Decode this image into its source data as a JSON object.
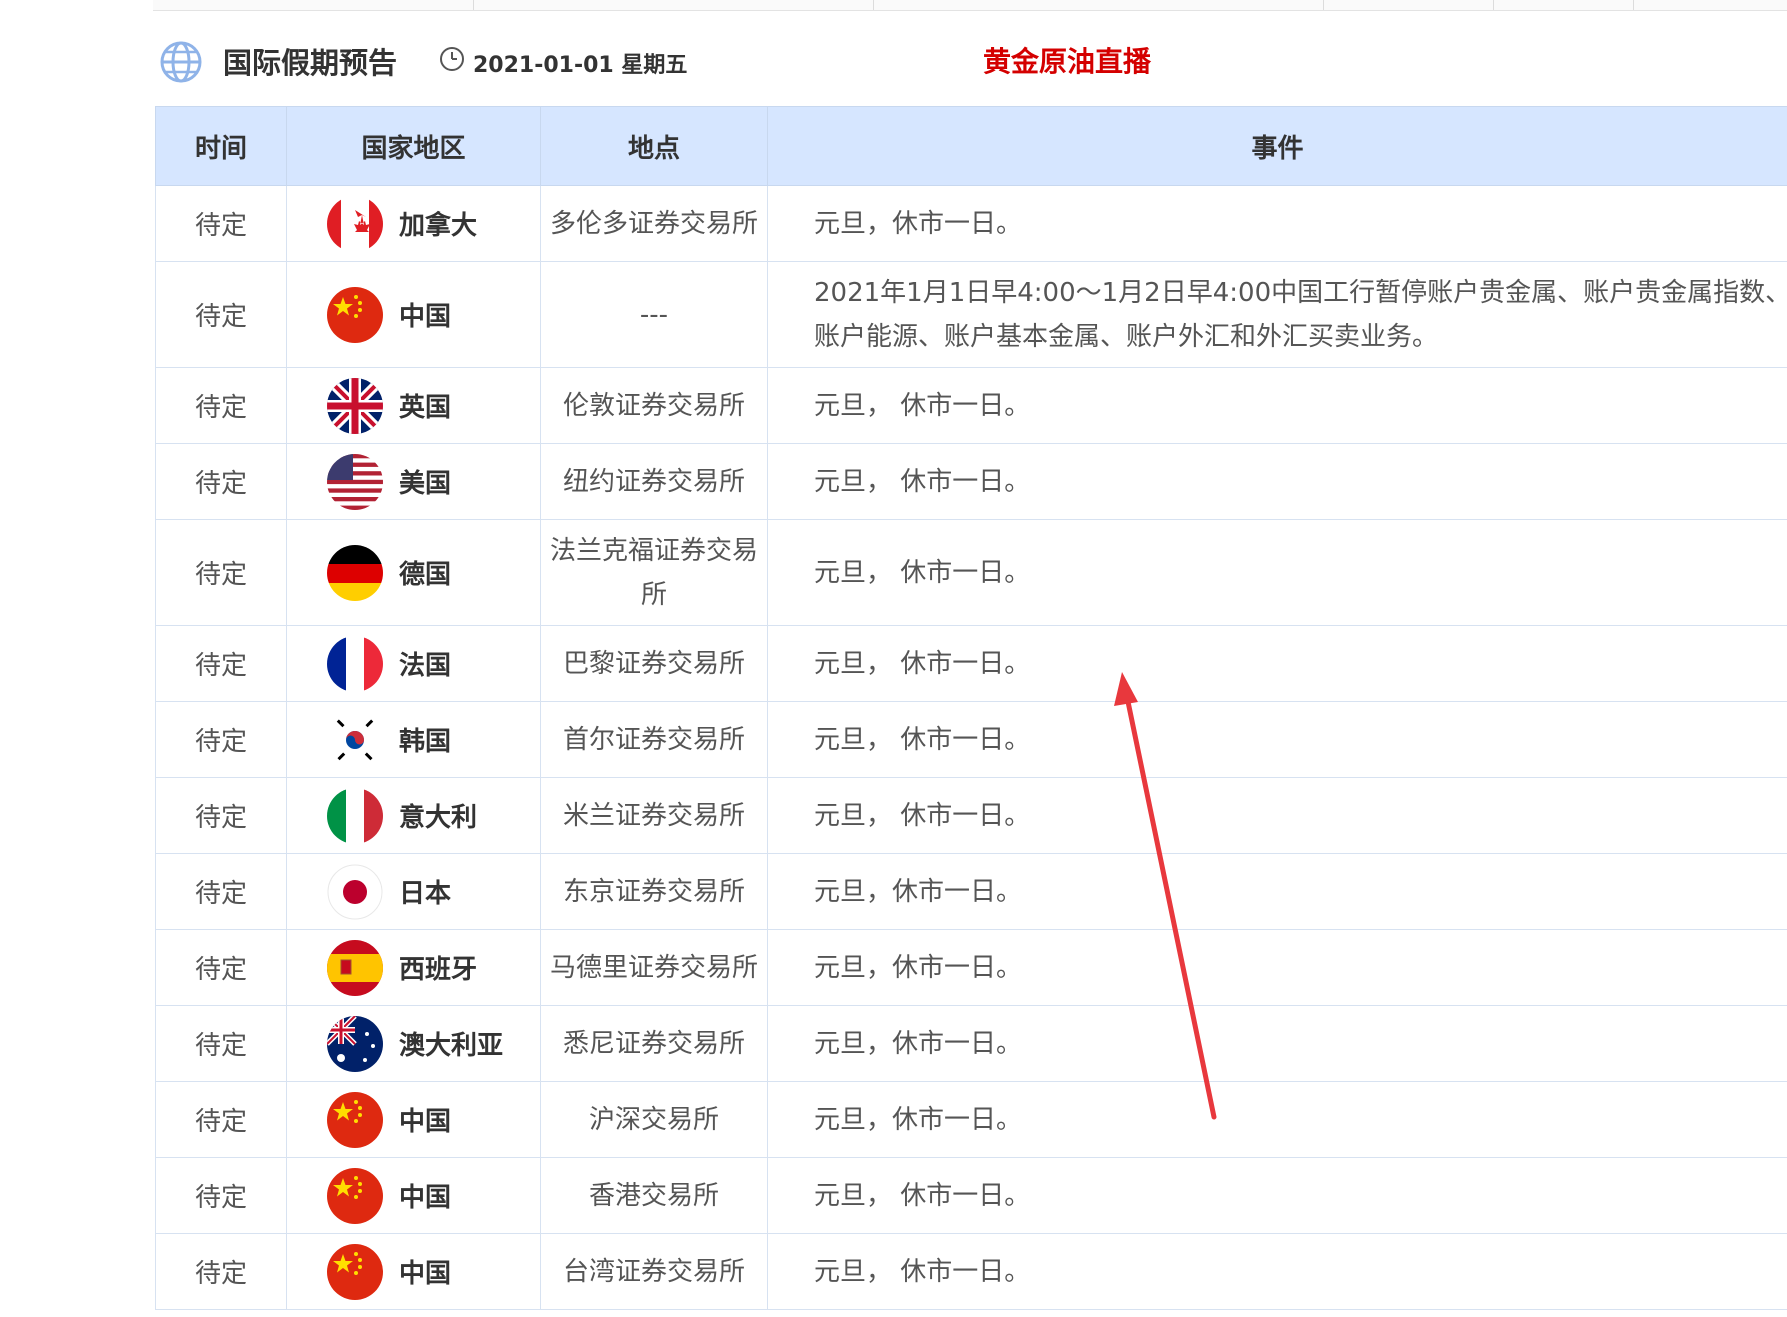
{
  "header": {
    "title": "国际假期预告",
    "date": "2021-01-01 星期五",
    "live_link": "黄金原油直播"
  },
  "table": {
    "columns": [
      "时间",
      "国家地区",
      "地点",
      "事件"
    ],
    "rows": [
      {
        "time": "待定",
        "country": "加拿大",
        "flag": "canada-flag-icon",
        "place": "多伦多证券交易所",
        "event": "元旦，休市一日。"
      },
      {
        "time": "待定",
        "country": "中国",
        "flag": "china-flag-icon",
        "place": "---",
        "event": "2021年1月1日早4:00～1月2日早4:00中国工行暂停账户贵金属、账户贵金属指数、账户能源、账户基本金属、账户外汇和外汇买卖业务。"
      },
      {
        "time": "待定",
        "country": "英国",
        "flag": "uk-flag-icon",
        "place": "伦敦证券交易所",
        "event": "元旦， 休市一日。"
      },
      {
        "time": "待定",
        "country": "美国",
        "flag": "usa-flag-icon",
        "place": "纽约证券交易所",
        "event": "元旦， 休市一日。"
      },
      {
        "time": "待定",
        "country": "德国",
        "flag": "germany-flag-icon",
        "place": "法兰克福证券交易所",
        "event": "元旦， 休市一日。"
      },
      {
        "time": "待定",
        "country": "法国",
        "flag": "france-flag-icon",
        "place": "巴黎证券交易所",
        "event": "元旦， 休市一日。"
      },
      {
        "time": "待定",
        "country": "韩国",
        "flag": "korea-flag-icon",
        "place": "首尔证券交易所",
        "event": "元旦， 休市一日。"
      },
      {
        "time": "待定",
        "country": "意大利",
        "flag": "italy-flag-icon",
        "place": "米兰证券交易所",
        "event": "元旦， 休市一日。"
      },
      {
        "time": "待定",
        "country": "日本",
        "flag": "japan-flag-icon",
        "place": "东京证券交易所",
        "event": "元旦，休市一日。"
      },
      {
        "time": "待定",
        "country": "西班牙",
        "flag": "spain-flag-icon",
        "place": "马德里证券交易所",
        "event": "元旦，休市一日。"
      },
      {
        "time": "待定",
        "country": "澳大利亚",
        "flag": "australia-flag-icon",
        "place": "悉尼证券交易所",
        "event": "元旦，休市一日。"
      },
      {
        "time": "待定",
        "country": "中国",
        "flag": "china-flag-icon",
        "place": "沪深交易所",
        "event": "元旦，休市一日。"
      },
      {
        "time": "待定",
        "country": "中国",
        "flag": "china-flag-icon",
        "place": "香港交易所",
        "event": "元旦， 休市一日。"
      },
      {
        "time": "待定",
        "country": "中国",
        "flag": "china-flag-icon",
        "place": "台湾证券交易所",
        "event": "元旦， 休市一日。"
      }
    ]
  },
  "colors": {
    "header_bg": "#d6e6ff",
    "live_link": "#d40000",
    "arrow": "#e8383d"
  }
}
